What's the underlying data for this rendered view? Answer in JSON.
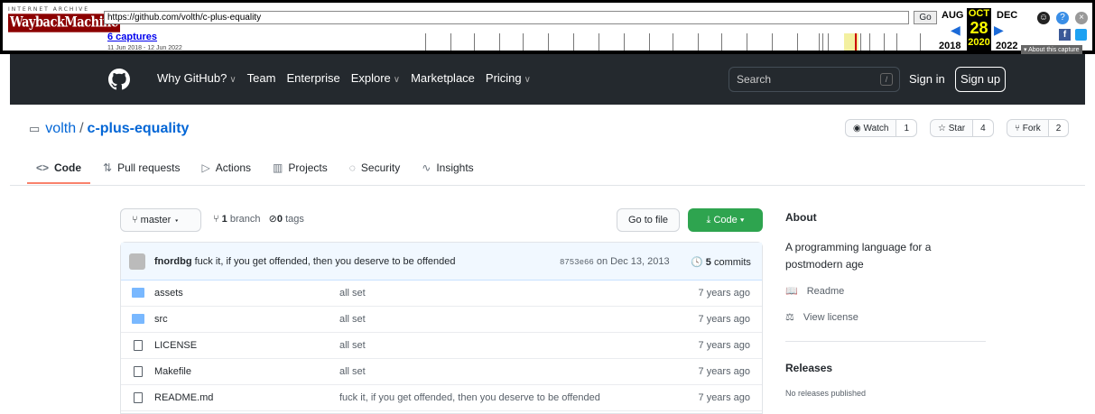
{
  "wayback": {
    "brand_top": "INTERNET ARCHIVE",
    "brand_main": "WaybackMachine",
    "url": "https://github.com/volth/c-plus-equality",
    "go": "Go",
    "captures": "6 captures",
    "range": "11 Jun 2018 - 12 Jun 2022",
    "month_prev": "AUG",
    "month_cur": "OCT",
    "month_next": "DEC",
    "day": "28",
    "year_prev": "2018",
    "year_cur": "2020",
    "year_next": "2022",
    "about": "About this capture"
  },
  "header": {
    "nav": [
      {
        "label": "Why GitHub?",
        "dropdown": true
      },
      {
        "label": "Team",
        "dropdown": false
      },
      {
        "label": "Enterprise",
        "dropdown": false
      },
      {
        "label": "Explore",
        "dropdown": true
      },
      {
        "label": "Marketplace",
        "dropdown": false
      },
      {
        "label": "Pricing",
        "dropdown": true
      }
    ],
    "search_placeholder": "Search",
    "search_key": "/",
    "signin": "Sign in",
    "signup": "Sign up"
  },
  "repo": {
    "owner": "volth",
    "name": "c-plus-equality",
    "watch_label": "Watch",
    "watch_count": "1",
    "star_label": "Star",
    "star_count": "4",
    "fork_label": "Fork",
    "fork_count": "2"
  },
  "tabs": [
    {
      "label": "Code",
      "icon": "<>"
    },
    {
      "label": "Pull requests",
      "icon": "⇅"
    },
    {
      "label": "Actions",
      "icon": "▷"
    },
    {
      "label": "Projects",
      "icon": "▥"
    },
    {
      "label": "Security",
      "icon": "◌"
    },
    {
      "label": "Insights",
      "icon": "∿"
    }
  ],
  "branch": {
    "name": "master",
    "branches_count": "1",
    "branches_label": "branch",
    "tags_count": "0",
    "tags_label": "tags",
    "goto_file": "Go to file",
    "code_btn": "Code"
  },
  "commit": {
    "author": "fnordbg",
    "message": "fuck it, if you get offended, then you deserve to be offended",
    "sha": "8753e66",
    "date": "on Dec 13, 2013",
    "commits_count": "5",
    "commits_label": "commits"
  },
  "files": [
    {
      "name": "assets",
      "type": "folder",
      "message": "all set",
      "age": "7 years ago"
    },
    {
      "name": "src",
      "type": "folder",
      "message": "all set",
      "age": "7 years ago"
    },
    {
      "name": "LICENSE",
      "type": "file",
      "message": "all set",
      "age": "7 years ago"
    },
    {
      "name": "Makefile",
      "type": "file",
      "message": "all set",
      "age": "7 years ago"
    },
    {
      "name": "README.md",
      "type": "file",
      "message": "fuck it, if you get offended, then you deserve to be offended",
      "age": "7 years ago"
    }
  ],
  "sidebar": {
    "about_title": "About",
    "description": "A programming language for a postmodern age",
    "readme": "Readme",
    "license": "View license",
    "releases_title": "Releases",
    "releases_none": "No releases published"
  }
}
